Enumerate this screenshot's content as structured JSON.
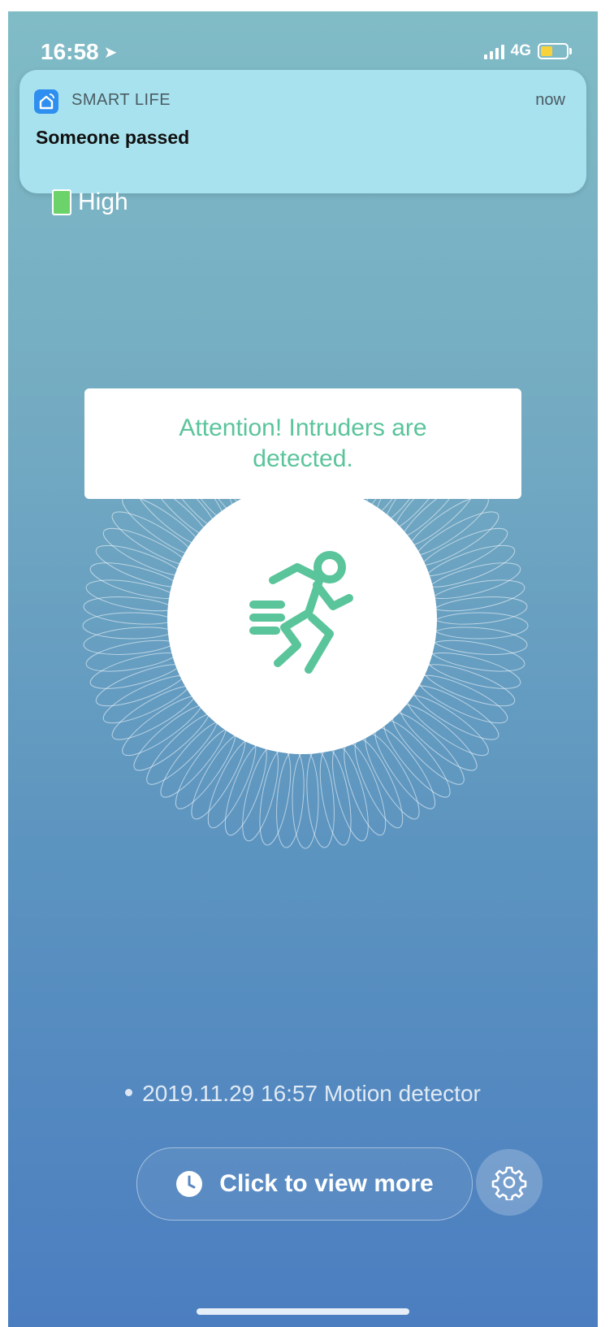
{
  "status_bar": {
    "time": "16:58",
    "network": "4G"
  },
  "notification": {
    "app": "SMART LIFE",
    "time": "now",
    "message": "Someone passed"
  },
  "sensitivity": {
    "label": "High"
  },
  "alert": {
    "message": "Attention! Intruders are detected."
  },
  "record": {
    "text": "2019.11.29 16:57 Motion detector"
  },
  "actions": {
    "view_more_label": "Click to view more"
  },
  "colors": {
    "accent_green": "#5ac49b",
    "battery_level": "#f7d23c",
    "sensitivity_indicator": "#6cd36a"
  }
}
